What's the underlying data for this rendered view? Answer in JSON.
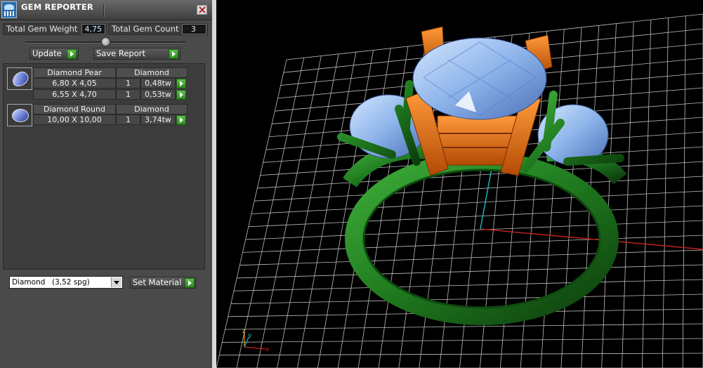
{
  "window": {
    "title": "GEM REPORTER"
  },
  "summary": {
    "total_weight_label": "Total Gem Weight",
    "total_weight_value": "4,75",
    "total_count_label": "Total Gem Count",
    "total_count_value": "3"
  },
  "actions": {
    "update_label": "Update",
    "save_report_label": "Save Report"
  },
  "gem_groups": [
    {
      "name": "Diamond Pear",
      "material": "Diamond",
      "icon": "pear-diamond-icon",
      "rows": [
        {
          "size": "6,80 X 4,05",
          "qty": "1",
          "weight": "0,48tw"
        },
        {
          "size": "6,55 X 4,70",
          "qty": "1",
          "weight": "0,53tw"
        }
      ]
    },
    {
      "name": "Diamond Round",
      "material": "Diamond",
      "icon": "round-diamond-icon",
      "rows": [
        {
          "size": "10,00 X 10,00",
          "qty": "1",
          "weight": "3,74tw"
        }
      ]
    }
  ],
  "material": {
    "name": "Diamond",
    "spg": "(3,52 spg)",
    "set_label": "Set Material"
  },
  "viewport": {
    "axis_labels": {
      "x": "x",
      "y": "y",
      "z": "z"
    },
    "colors": {
      "metal": "#1f7a1f",
      "prongs": "#e06a10",
      "gem": "#7fa8e0",
      "grid": "#bfbfbf",
      "x_axis": "#c02020",
      "y_axis": "#20b0c0"
    }
  }
}
